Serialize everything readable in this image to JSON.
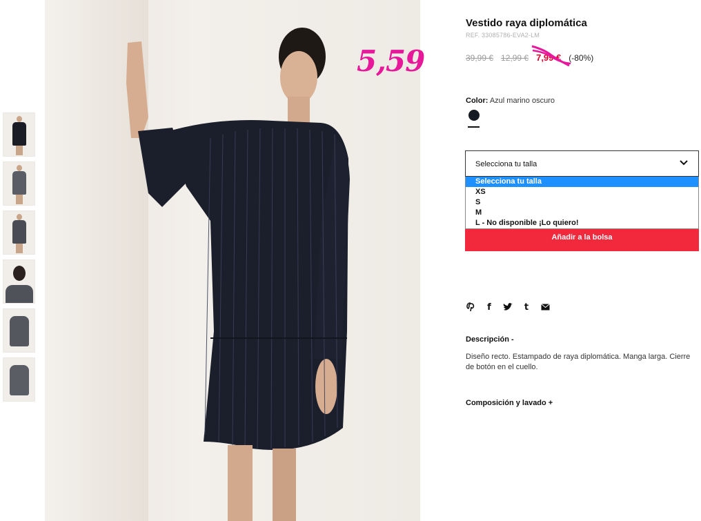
{
  "product": {
    "title": "Vestido raya diplomática",
    "ref": "REF. 33085786-EVA2-LM",
    "price_original": "39,99 €",
    "price_previous": "12,99 €",
    "price_sale": "7,99 €",
    "discount": "(-80%)",
    "handwritten_price": "5,59"
  },
  "color": {
    "label": "Color:",
    "value": "Azul marino oscuro",
    "swatch_hex": "#161a24"
  },
  "size_select": {
    "selected": "Selecciona tu talla",
    "options": [
      "Selecciona tu talla",
      "XS",
      "S",
      "M",
      "L - No disponible ¡Lo quiero!"
    ]
  },
  "add_to_bag": "Añadir a la bolsa",
  "share_icons": [
    "pinterest-icon",
    "facebook-icon",
    "twitter-icon",
    "tumblr-icon",
    "email-icon"
  ],
  "description": {
    "heading": "Descripción -",
    "text": "Diseño recto. Estampado de raya diplomática. Manga larga. Cierre de botón en el cuello."
  },
  "composition": {
    "heading": "Composición y lavado +"
  },
  "colors": {
    "sale_red": "#e0002b",
    "button_red": "#f2293c",
    "handwritten_pink": "#e6199b",
    "dropdown_highlight": "#1e90ff"
  }
}
